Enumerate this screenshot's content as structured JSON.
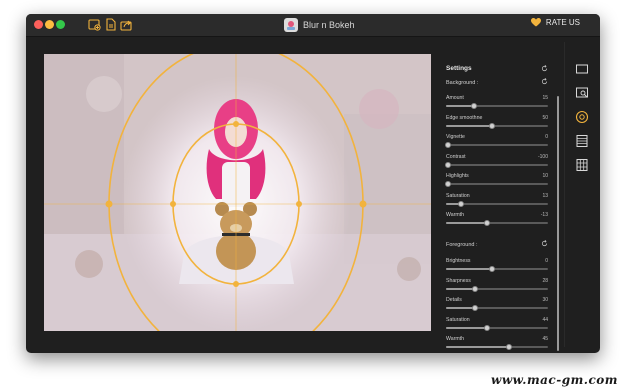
{
  "app": {
    "title": "Blur n Bokeh",
    "rate_label": "RATE US"
  },
  "colors": {
    "accent": "#f2b33d",
    "window_bg": "#1f1f1f",
    "panel_text": "#cfcfcf"
  },
  "toolbar": {
    "icons": [
      "add-photo-icon",
      "export-document-icon",
      "share-icon"
    ]
  },
  "settings": {
    "title": "Settings",
    "background_label": "Background :",
    "foreground_label": "Foreground :",
    "background": [
      {
        "label": "Amount",
        "value": "15",
        "fraction": 0.27
      },
      {
        "label": "Edge smoothne",
        "value": "50",
        "fraction": 0.45
      },
      {
        "label": "Vignette",
        "value": "0",
        "fraction": 0.02
      },
      {
        "label": "Contrast",
        "value": "-100",
        "fraction": 0.02
      },
      {
        "label": "Highlights",
        "value": "10",
        "fraction": 0.02
      },
      {
        "label": "Saturation",
        "value": "13",
        "fraction": 0.15
      },
      {
        "label": "Warmth",
        "value": "-13",
        "fraction": 0.4
      }
    ],
    "foreground": [
      {
        "label": "Brightness",
        "value": "0",
        "fraction": 0.45
      },
      {
        "label": "Sharpness",
        "value": "28",
        "fraction": 0.28
      },
      {
        "label": "Details",
        "value": "30",
        "fraction": 0.28
      },
      {
        "label": "Saturation",
        "value": "44",
        "fraction": 0.4
      },
      {
        "label": "Warmth",
        "value": "45",
        "fraction": 0.62
      }
    ]
  },
  "right_tools": [
    "crop-icon",
    "zoom-region-icon",
    "focus-circle-icon",
    "list-layers-icon",
    "grid-icon"
  ],
  "watermark": "www.mac-gm.com"
}
